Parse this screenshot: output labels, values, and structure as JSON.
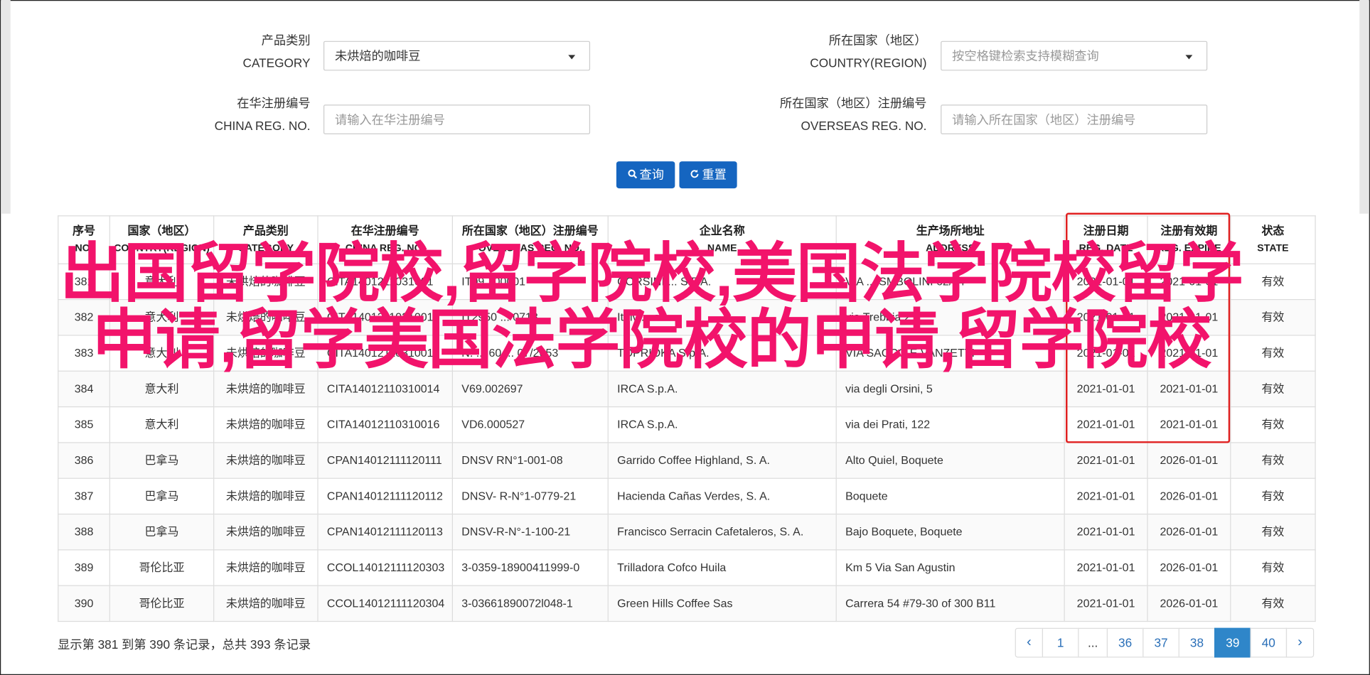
{
  "filters": {
    "category": {
      "label_cn": "产品类别",
      "label_en": "CATEGORY",
      "value": "未烘焙的咖啡豆"
    },
    "country": {
      "label_cn": "所在国家（地区）",
      "label_en": "COUNTRY(REGION)",
      "placeholder": "按空格键检索支持模糊查询"
    },
    "china_reg": {
      "label_cn": "在华注册编号",
      "label_en": "CHINA REG. NO.",
      "placeholder": "请输入在华注册编号"
    },
    "overseas_reg": {
      "label_cn": "所在国家（地区）注册编号",
      "label_en": "OVERSEAS REG. NO.",
      "placeholder": "请输入所在国家（地区）注册编号"
    }
  },
  "buttons": {
    "search": "查询",
    "reset": "重置"
  },
  "table": {
    "headers": [
      {
        "cn": "序号",
        "en": "NO."
      },
      {
        "cn": "国家（地区）",
        "en": "COUNTRY(REGION)"
      },
      {
        "cn": "产品类别",
        "en": "CATEGORY"
      },
      {
        "cn": "在华注册编号",
        "en": "CHINA REG. NO."
      },
      {
        "cn": "所在国家（地区）注册编号",
        "en": "OVERSEAS REG. NO."
      },
      {
        "cn": "企业名称",
        "en": "NAME"
      },
      {
        "cn": "生产场所地址",
        "en": "ADDRESS"
      },
      {
        "cn": "注册日期",
        "en": "REG. DATE"
      },
      {
        "cn": "注册有效期",
        "en": "REG. EXPIRE"
      },
      {
        "cn": "状态",
        "en": "STATE"
      }
    ],
    "rows": [
      [
        "381",
        "意大利",
        "未烘焙的咖啡豆",
        "CITA1401211031001",
        "IT09...00001",
        "CORSINI ... S.P.A.",
        "VIA ... SMBOLINI 62/64",
        "2021-01-01",
        "2021-01-01",
        "有效"
      ],
      [
        "382",
        "意大利",
        "未烘焙的咖啡豆",
        "CITA1401211031001",
        "IT2950 ... 0718",
        "Italv ... s.l.",
        "via Trebbia 2",
        "2021-01-01",
        "2021-01-01",
        "有效"
      ],
      [
        "383",
        "意大利",
        "未烘焙的咖啡豆",
        "CITA14012110310013",
        "N. ... 60 ... 07/2053",
        "TOPRIOKA S.p.A.",
        "VIA SACCO E VANZETTI",
        "2021-01-01",
        "2021-01-01",
        "有效"
      ],
      [
        "384",
        "意大利",
        "未烘焙的咖啡豆",
        "CITA14012110310014",
        "V69.002697",
        "IRCA S.p.A.",
        "via degli Orsini, 5",
        "2021-01-01",
        "2021-01-01",
        "有效"
      ],
      [
        "385",
        "意大利",
        "未烘焙的咖啡豆",
        "CITA14012110310016",
        "VD6.000527",
        "IRCA S.p.A.",
        "via dei Prati, 122",
        "2021-01-01",
        "2021-01-01",
        "有效"
      ],
      [
        "386",
        "巴拿马",
        "未烘焙的咖啡豆",
        "CPAN14012111120111",
        "DNSV RN°1-001-08",
        "Garrido Coffee Highland, S. A.",
        "Alto Quiel, Boquete",
        "2021-01-01",
        "2026-01-01",
        "有效"
      ],
      [
        "387",
        "巴拿马",
        "未烘焙的咖啡豆",
        "CPAN14012111120112",
        "DNSV- R-N°1-0779-21",
        "Hacienda Cañas Verdes, S. A.",
        "Boquete",
        "2021-01-01",
        "2026-01-01",
        "有效"
      ],
      [
        "388",
        "巴拿马",
        "未烘焙的咖啡豆",
        "CPAN14012111120113",
        "DNSV-R-N°-1-100-21",
        "Francisco Serracin Cafetaleros, S. A.",
        "Bajo Boquete, Boquete",
        "2021-01-01",
        "2026-01-01",
        "有效"
      ],
      [
        "389",
        "哥伦比亚",
        "未烘焙的咖啡豆",
        "CCOL14012111120303",
        "3-0359-18900411999-0",
        "Trilladora Cofco Huila",
        "Km 5 Via San Agustin",
        "2021-01-01",
        "2026-01-01",
        "有效"
      ],
      [
        "390",
        "哥伦比亚",
        "未烘焙的咖啡豆",
        "CCOL14012111120304",
        "3-03661890072l048-1",
        "Green Hills Coffee Sas",
        "Carrera 54 #79-30 of 300 B11",
        "2021-01-01",
        "2026-01-01",
        "有效"
      ]
    ]
  },
  "overlay_text": "出国留学院校,留学院校,美国法学院校留学申请,留学美国法学院校的申请,留学院校",
  "summary": "显示第 381 到第 390 条记录，总共 393 条记录",
  "pagination": {
    "prev": "‹",
    "next": "›",
    "pages": [
      "1",
      "...",
      "36",
      "37",
      "38",
      "39",
      "40"
    ],
    "active": "39"
  }
}
